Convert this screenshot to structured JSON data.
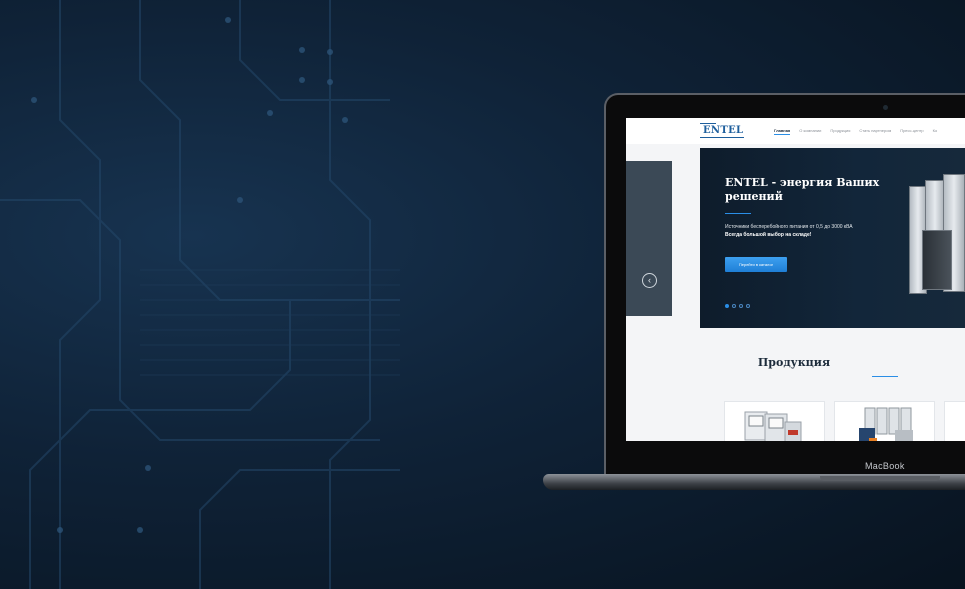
{
  "device": {
    "brand": "MacBook"
  },
  "site": {
    "logo": "ENTEL",
    "nav": [
      "Главная",
      "О компании",
      "Продукция",
      "Стать партнером",
      "Пресс-центр",
      "Ко"
    ],
    "hero": {
      "title": "ENTEL - энергия Ваших решений",
      "subtitle": "Источники бесперебойного питания от 0,5 до 3000 кВА",
      "subtitle_bold": "Всегда большой выбор на складе!",
      "cta": "Перейти в каталог",
      "slide_count": 4,
      "active_slide": 1
    },
    "prev_arrow": "‹",
    "products": {
      "title": "Продукция"
    }
  },
  "icons": {
    "prev-arrow": "chevron-left-icon",
    "slider-dots": "pagination-dots"
  },
  "colors": {
    "accent": "#2a8ee6",
    "brand": "#1d5e9c",
    "hero_bg": "#12263a"
  }
}
